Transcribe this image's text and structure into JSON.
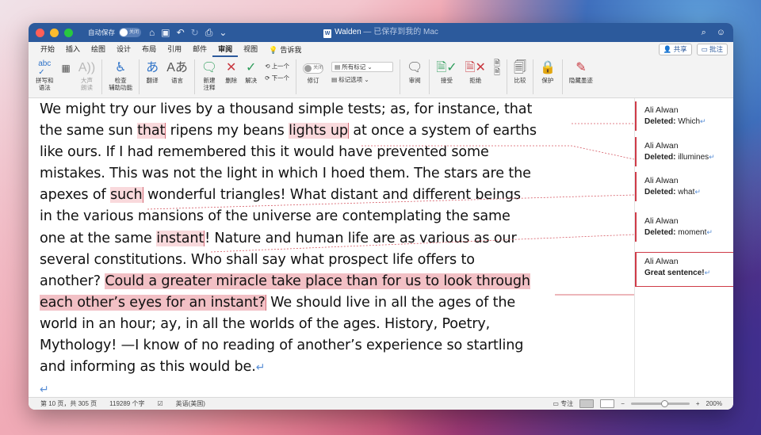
{
  "titlebar": {
    "autosave_label": "自动保存",
    "autosave_state": "关闭",
    "doc_name": "Walden",
    "doc_status": " — 已保存到我的 Mac",
    "doc_icon": "W"
  },
  "tabs": {
    "items": [
      "开始",
      "插入",
      "绘图",
      "设计",
      "布局",
      "引用",
      "邮件",
      "审阅",
      "视图"
    ],
    "active": "审阅",
    "help": "告诉我",
    "share": "共享",
    "comments": "批注"
  },
  "ribbon": {
    "spelling": "拼写和\n语法",
    "read_aloud": "大声\n朗读",
    "accessibility": "检查\n辅助功能",
    "translate": "翻译",
    "language": "语言",
    "new_comment": "新建\n注释",
    "delete": "删除",
    "resolve": "解决",
    "prev": "上一个",
    "next": "下一个",
    "track_toggle_state": "关闭",
    "track_changes": "修订",
    "all_markup": "所有标记",
    "markup_options": "标记选项",
    "reviewing": "审阅",
    "accept": "接受",
    "reject": "拒绝",
    "compare": "比较",
    "protect": "保护",
    "hide_ink": "隐藏墨迹"
  },
  "document": {
    "lines": [
      [
        {
          "t": "We might try our lives by a thousand simple tests; as, for instance, that"
        }
      ],
      [
        {
          "t": "the same sun "
        },
        {
          "t": "that",
          "ins": true
        },
        {
          "t": " ripens my beans "
        },
        {
          "t": "lights up",
          "ins": true
        },
        {
          "t": " at once a system of earths"
        }
      ],
      [
        {
          "t": "like ours. If I had remembered this it would have prevented some"
        }
      ],
      [
        {
          "t": "mistakes. This was not the light in which I hoed them. The stars are the"
        }
      ],
      [
        {
          "t": "apexes of "
        },
        {
          "t": "such",
          "ins": true
        },
        {
          "t": " wonderful triangles! What distant and different beings"
        }
      ],
      [
        {
          "t": "in the various mansions of the universe are contemplating the same"
        }
      ],
      [
        {
          "t": "one at the same "
        },
        {
          "t": "instant",
          "ins": true
        },
        {
          "t": "! Nature and human life are as various as our"
        }
      ],
      [
        {
          "t": "several constitutions. Who shall say what prospect life offers to"
        }
      ],
      [
        {
          "t": "another? "
        },
        {
          "t": "Could a greater miracle take place than for us to look through",
          "big": true
        }
      ],
      [
        {
          "t": "each other’s eyes for an instant?",
          "big": true,
          "ins": true
        },
        {
          "t": " We should live in all the ages of the"
        }
      ],
      [
        {
          "t": "world in an hour; ay, in all the worlds of the ages. History, Poetry,"
        }
      ],
      [
        {
          "t": "Mythology! —I know of no reading of another’s experience so startling"
        }
      ],
      [
        {
          "t": "and informing as this would be."
        },
        {
          "t": "↵",
          "mark": true
        }
      ],
      [
        {
          "t": "↵",
          "mark": true
        }
      ]
    ],
    "balloons": [
      {
        "author": "Ali Alwan",
        "kind": "Deleted",
        "text": "Which"
      },
      {
        "author": "Ali Alwan",
        "kind": "Deleted",
        "text": "illumines"
      },
      {
        "author": "Ali Alwan",
        "kind": "Deleted",
        "text": "what"
      },
      {
        "author": "Ali Alwan",
        "kind": "Deleted",
        "text": "moment"
      },
      {
        "author": "Ali Alwan",
        "kind": "",
        "text": "Great sentence!"
      }
    ]
  },
  "statusbar": {
    "page": "第 10 页，共 305 页",
    "words": "119289 个字",
    "language": "英语(美国)",
    "focus": "专注",
    "zoom": "200%"
  },
  "colors": {
    "titlebar": "#2c5a9c",
    "insert_highlight": "#f9d9dc",
    "comment_highlight": "#f2c0c5",
    "revision_red": "#cf3b48"
  }
}
